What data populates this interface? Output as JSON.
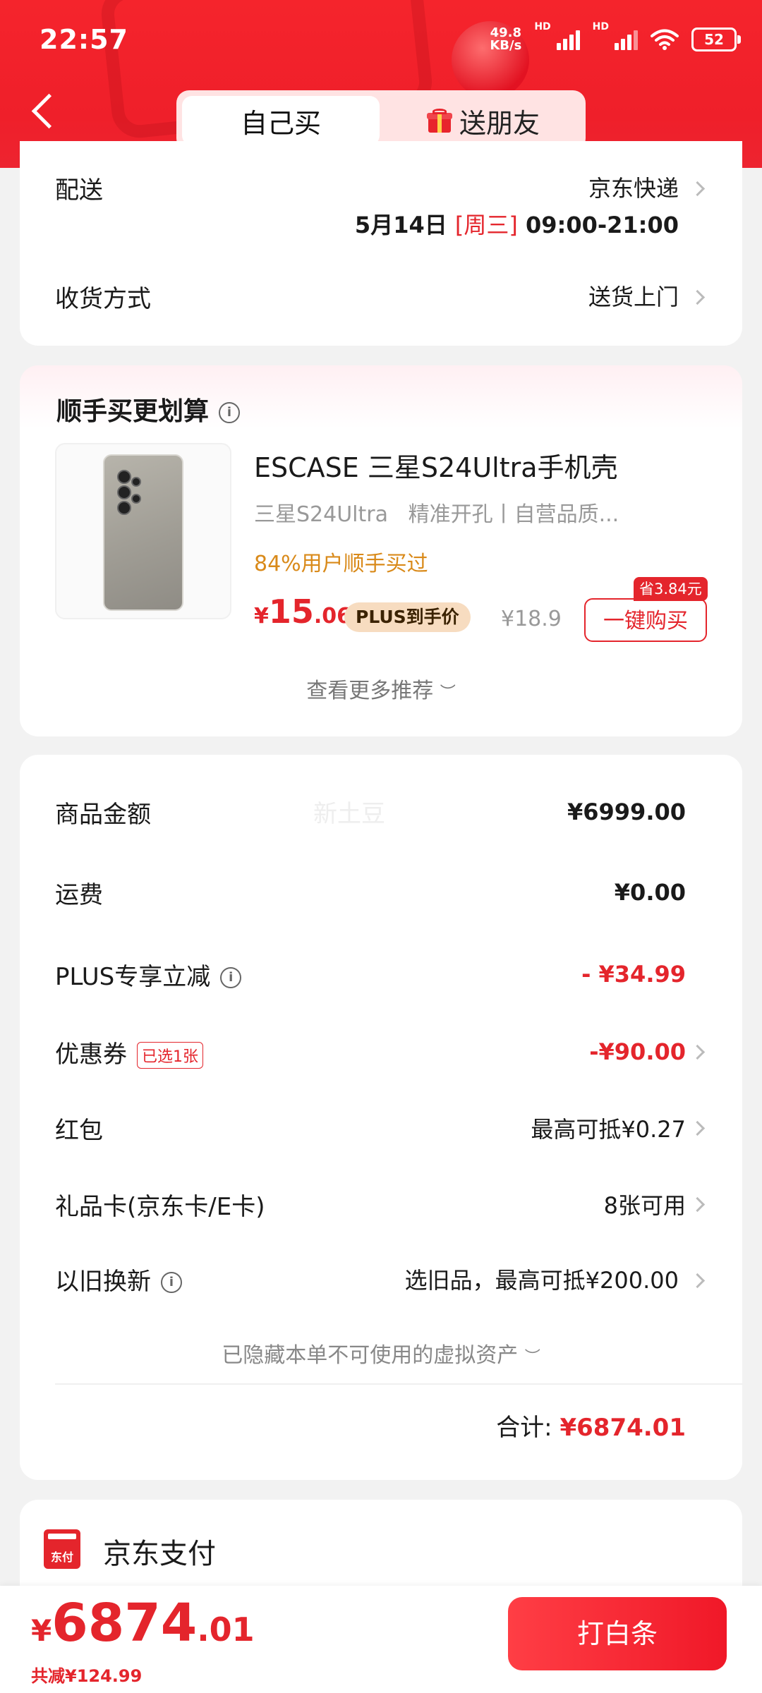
{
  "status_bar": {
    "time": "22:57",
    "net_speed": "49.8",
    "net_unit": "KB/s",
    "hd1": "HD",
    "hd2": "HD",
    "battery": "52"
  },
  "header": {
    "tab_self": "自己买",
    "tab_gift": "送朋友"
  },
  "delivery": {
    "label": "配送",
    "carrier": "京东快递",
    "date": "5月14日",
    "weekday": "[周三]",
    "time_range": "09:00-21:00",
    "receive_label": "收货方式",
    "receive_value": "送货上门"
  },
  "addon": {
    "title": "顺手买更划算",
    "info_icon": "i",
    "product_title": "ESCASE 三星S24Ultra手机壳",
    "product_sub": "三星S24Ultra   精准开孔丨自营品质...",
    "popularity": "84%用户顺手买过",
    "price_symbol": "¥",
    "price_int": "15",
    "price_dec": ".06",
    "plus_tag": "PLUS到手价",
    "original_price": "¥18.9",
    "save_badge": "省3.84元",
    "buy_button": "一键购买",
    "more": "查看更多推荐"
  },
  "summary": {
    "watermark": "新土豆",
    "items": [
      {
        "label": "商品金额",
        "value": "¥6999.00"
      },
      {
        "label": "运费",
        "value": "¥0.00"
      },
      {
        "label": "PLUS专享立减",
        "value": "- ¥34.99"
      },
      {
        "label": "优惠券",
        "tag": "已选1张",
        "value": "-¥90.00"
      },
      {
        "label": "红包",
        "value": "最高可抵¥0.27"
      },
      {
        "label": "礼品卡(京东卡/E卡)",
        "value": "8张可用"
      },
      {
        "label": "以旧换新",
        "value": "选旧品，最高可抵¥200.00"
      }
    ],
    "hidden_assets": "已隐藏本单不可使用的虚拟资产",
    "total_label": "合计:",
    "total_value": "¥6874.01"
  },
  "payment": {
    "icon_text": "东付",
    "label": "京东支付"
  },
  "bottom_bar": {
    "currency": "¥",
    "amount_int": "6874",
    "amount_dec": ".01",
    "saved": "共减¥124.99",
    "pay_button": "打白条"
  },
  "colors": {
    "brand_red": "#e4252c",
    "header_red": "#f5242c",
    "plus_gold": "#f7dcc0",
    "orange_text": "#d98a1a"
  }
}
